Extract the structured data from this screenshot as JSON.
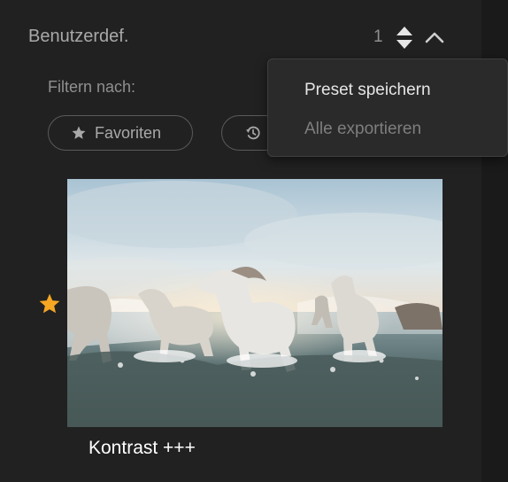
{
  "header": {
    "title": "Benutzerdef.",
    "count": "1"
  },
  "filter": {
    "label": "Filtern nach:",
    "favorites_label": "Favoriten"
  },
  "menu": {
    "items": [
      {
        "label": "Preset speichern",
        "enabled": true
      },
      {
        "label": "Alle exportieren",
        "enabled": false
      }
    ]
  },
  "preset": {
    "name": "Kontrast +++",
    "favorite": true,
    "thumbnail": "white horses running through water"
  },
  "icons": {
    "stepper": "up-down-arrows-icon",
    "collapse": "chevron-up-icon",
    "favorites": "star-icon",
    "recent": "history-icon",
    "favorite_badge": "star-icon"
  },
  "colors": {
    "panel_bg": "#212121",
    "text_muted": "#a9a9a9",
    "favorite_star": "#f5a623",
    "menu_bg": "#2a2a2a"
  }
}
